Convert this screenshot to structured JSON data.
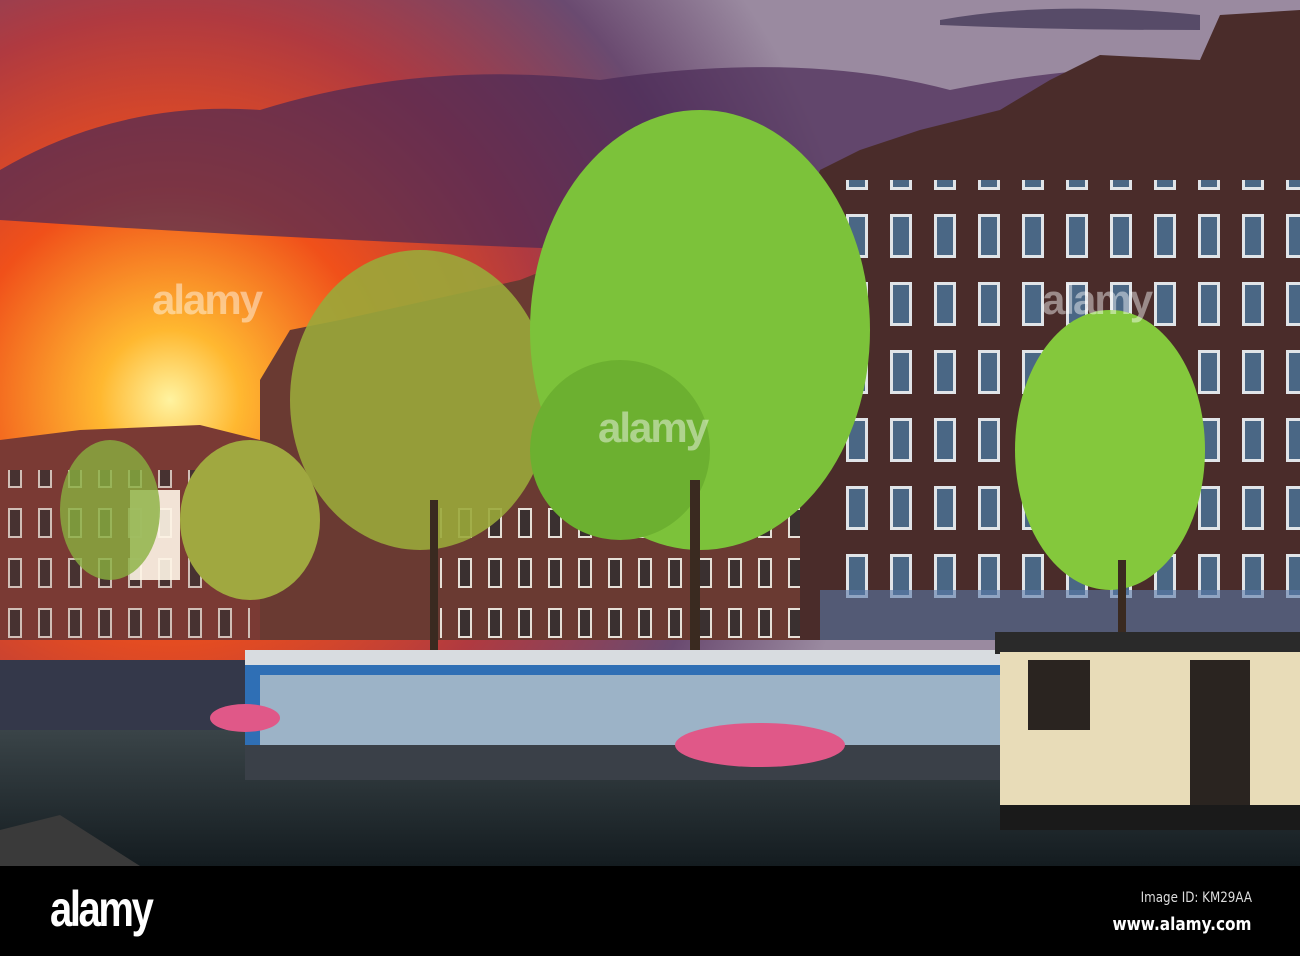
{
  "photo": {
    "subject": "Amsterdam canal with houseboats at sunset",
    "colors": {
      "sun": "#ffd24a",
      "sky_orange": "#f0501a",
      "cloud": "#4a2a55",
      "brick": "#4a2c2a",
      "tree": "#7cc23a",
      "water": "#1e2a30",
      "boat_blue": "#2f6fb5",
      "boat_cream": "#e8dcb8"
    }
  },
  "watermark": {
    "text": "alamy"
  },
  "footer": {
    "logo": "alamy",
    "image_id": "Image ID: KM29AA",
    "url": "www.alamy.com"
  }
}
